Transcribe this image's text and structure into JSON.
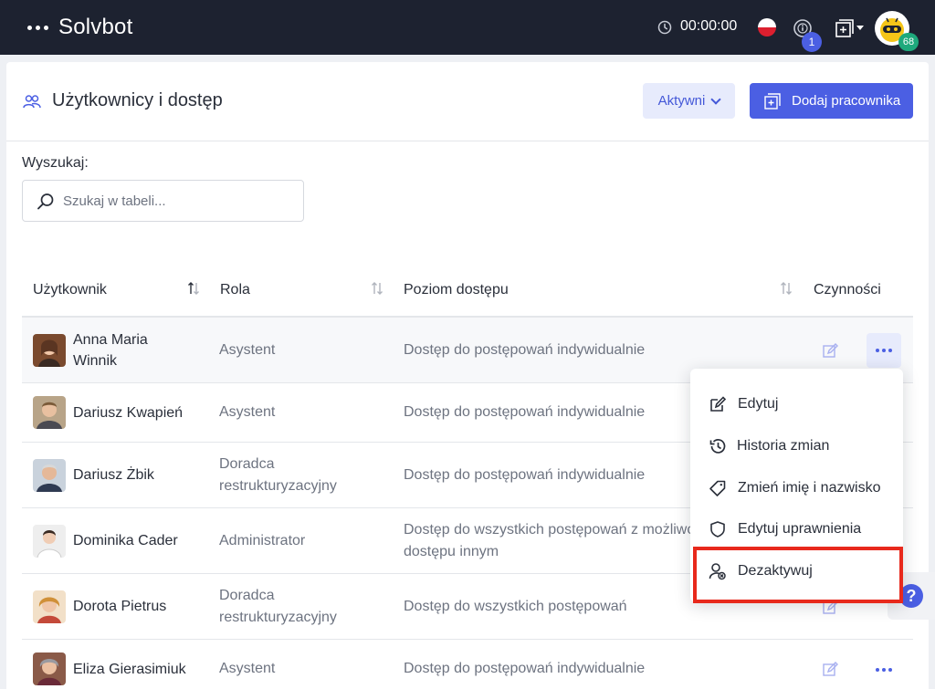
{
  "app": {
    "name": "Solvbot"
  },
  "topbar": {
    "timer": "00:00:00",
    "notifications_count": "1",
    "bot_badge": "68"
  },
  "page": {
    "title": "Użytkownicy i dostęp",
    "filter_label": "Aktywni",
    "add_button": "Dodaj pracownika"
  },
  "search": {
    "label": "Wyszukaj:",
    "placeholder": "Szukaj w tabeli..."
  },
  "table": {
    "headers": {
      "user": "Użytkownik",
      "role": "Rola",
      "access": "Poziom dostępu",
      "actions": "Czynności"
    },
    "rows": [
      {
        "name": "Anna Maria Winnik",
        "role": "Asystent",
        "access": "Dostęp do postępowań indywidualnie"
      },
      {
        "name": "Dariusz Kwapień",
        "role": "Asystent",
        "access": "Dostęp do postępowań indywidualnie"
      },
      {
        "name": "Dariusz Żbik",
        "role": "Doradca restrukturyzacyjny",
        "access": "Dostęp do postępowań indywidualnie"
      },
      {
        "name": "Dominika Cader",
        "role": "Administrator",
        "access": "Dostęp do wszystkich postępowań z możliwo dostępu innym"
      },
      {
        "name": "Dorota Pietrus",
        "role": "Doradca restrukturyzacyjny",
        "access": "Dostęp do wszystkich postępowań"
      },
      {
        "name": "Eliza Gierasimiuk",
        "role": "Asystent",
        "access": "Dostęp do postępowań indywidualnie"
      }
    ]
  },
  "dropdown": {
    "items": [
      {
        "label": "Edytuj",
        "icon": "pencil-icon"
      },
      {
        "label": "Historia zmian",
        "icon": "history-icon"
      },
      {
        "label": "Zmień imię i nazwisko",
        "icon": "tag-icon"
      },
      {
        "label": "Edytuj uprawnienia",
        "icon": "shield-icon"
      },
      {
        "label": "Dezaktywuj",
        "icon": "user-remove-icon"
      }
    ]
  },
  "help": {
    "label": "?"
  },
  "colors": {
    "topbar": "#1d2230",
    "accent": "#4b5fe3",
    "highlight": "#e8291c",
    "success": "#1ea97c"
  }
}
